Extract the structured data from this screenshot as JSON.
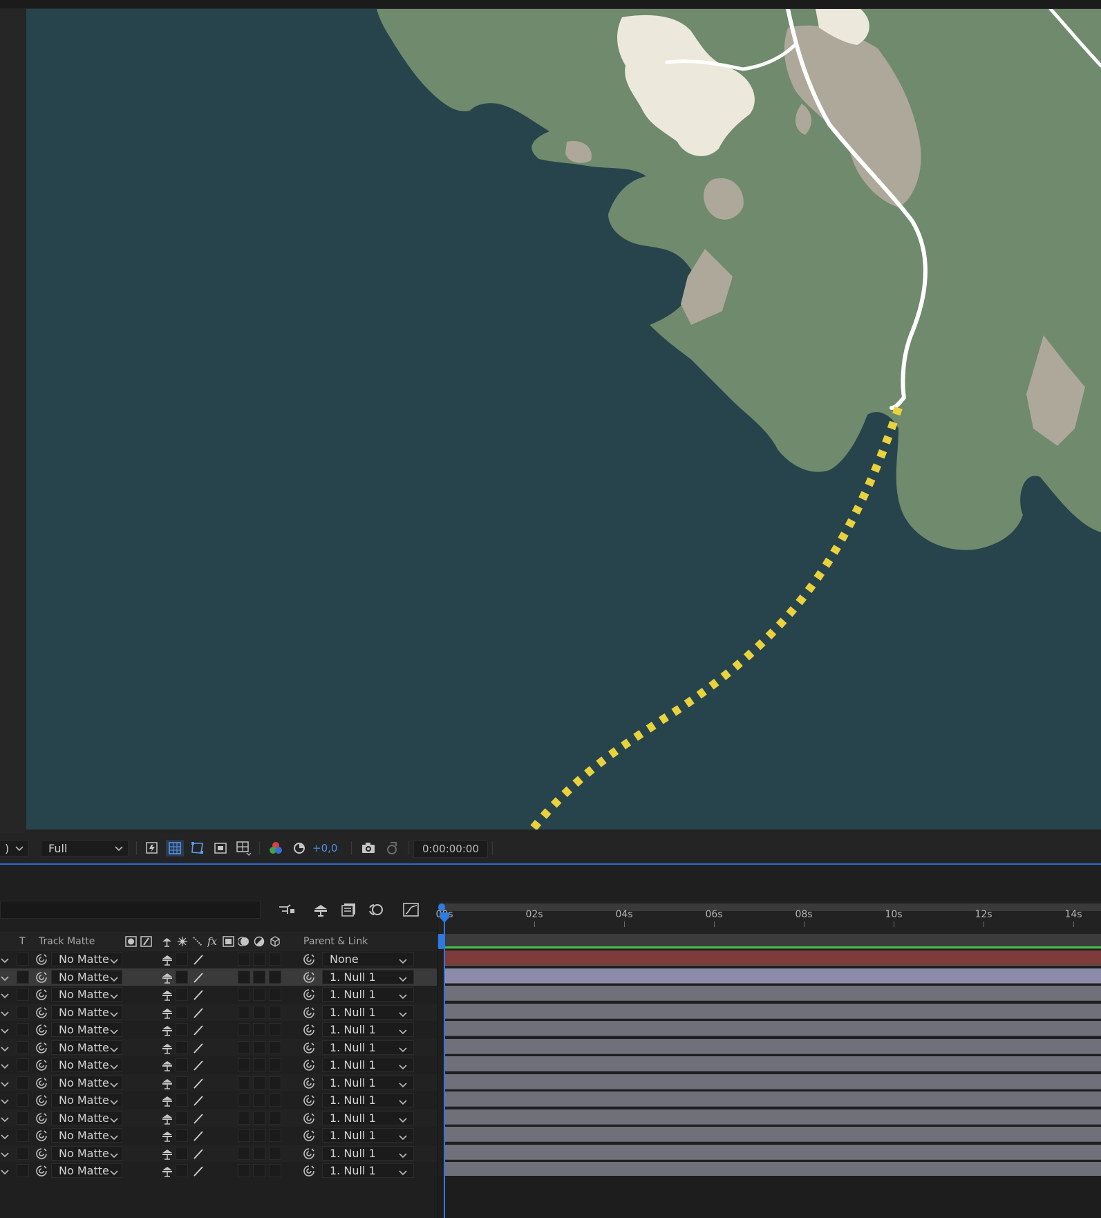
{
  "viewer": {
    "resolution_value": "Full",
    "left_dropdown_partial": ")",
    "exposure_value": "+0,0",
    "timecode": "0:00:00:00",
    "icons": [
      "fast-previews-icon",
      "transparency-grid-icon",
      "mask-visibility-icon",
      "region-of-interest-icon",
      "guides-icon",
      "color-channels-icon",
      "reset-exposure-icon",
      "snapshot-camera-icon",
      "show-snapshot-icon"
    ]
  },
  "map": {
    "colors": {
      "water": "#27444d",
      "land": "#6f8a6c",
      "urban": "#aea89a",
      "highlight": "#ece8dc",
      "road": "#ffffff",
      "route": "#e9d23b"
    }
  },
  "timeline": {
    "column_headers": {
      "shy_col": "T",
      "track_matte": "Track Matte",
      "parent_link": "Parent & Link"
    },
    "ruler_labels": [
      "00s",
      "02s",
      "04s",
      "06s",
      "08s",
      "10s",
      "12s",
      "14s"
    ],
    "layers": [
      {
        "track_matte": "No Matte",
        "parent": "None",
        "bar": "red"
      },
      {
        "track_matte": "No Matte",
        "parent": "1. Null 1",
        "bar": "selected"
      },
      {
        "track_matte": "No Matte",
        "parent": "1. Null 1",
        "bar": "normal"
      },
      {
        "track_matte": "No Matte",
        "parent": "1. Null 1",
        "bar": "normal"
      },
      {
        "track_matte": "No Matte",
        "parent": "1. Null 1",
        "bar": "normal"
      },
      {
        "track_matte": "No Matte",
        "parent": "1. Null 1",
        "bar": "normal"
      },
      {
        "track_matte": "No Matte",
        "parent": "1. Null 1",
        "bar": "normal"
      },
      {
        "track_matte": "No Matte",
        "parent": "1. Null 1",
        "bar": "normal"
      },
      {
        "track_matte": "No Matte",
        "parent": "1. Null 1",
        "bar": "normal"
      },
      {
        "track_matte": "No Matte",
        "parent": "1. Null 1",
        "bar": "normal"
      },
      {
        "track_matte": "No Matte",
        "parent": "1. Null 1",
        "bar": "normal"
      },
      {
        "track_matte": "No Matte",
        "parent": "1. Null 1",
        "bar": "normal"
      },
      {
        "track_matte": "No Matte",
        "parent": "1. Null 1",
        "bar": "normal"
      }
    ],
    "colors": {
      "playhead": "#2f7ae0",
      "work_area": "#3fbf3f",
      "bar_normal": "#6f707a",
      "bar_red": "#7d3b3b",
      "bar_selected": "#8c8caa"
    }
  }
}
